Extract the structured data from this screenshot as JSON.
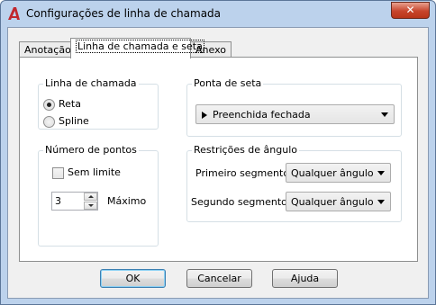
{
  "window": {
    "title": "Configurações de linha de chamada",
    "close_label": "✕"
  },
  "tabs": [
    {
      "label": "Anotação",
      "active": false
    },
    {
      "label": "Linha de chamada e seta",
      "active": true
    },
    {
      "label": "Anexo",
      "active": false
    }
  ],
  "leader_line": {
    "legend": "Linha de chamada",
    "options": [
      {
        "label": "Reta",
        "selected": true
      },
      {
        "label": "Spline",
        "selected": false
      }
    ]
  },
  "arrowhead": {
    "legend": "Ponta de seta",
    "selected": "Preenchida fechada"
  },
  "points": {
    "legend": "Número de pontos",
    "no_limit_label": "Sem limite",
    "no_limit_checked": false,
    "value": "3",
    "max_label": "Máximo"
  },
  "angle": {
    "legend": "Restrições de ângulo",
    "first_label": "Primeiro segmento:",
    "first_value": "Qualquer ângulo",
    "second_label": "Segundo segmento:",
    "second_value": "Qualquer ângulo"
  },
  "buttons": {
    "ok": "OK",
    "cancel": "Cancelar",
    "help": "Ajuda"
  },
  "colors": {
    "frame": "#bcd2ec",
    "close_button": "#c7452c",
    "app_icon": "#c1272d"
  }
}
